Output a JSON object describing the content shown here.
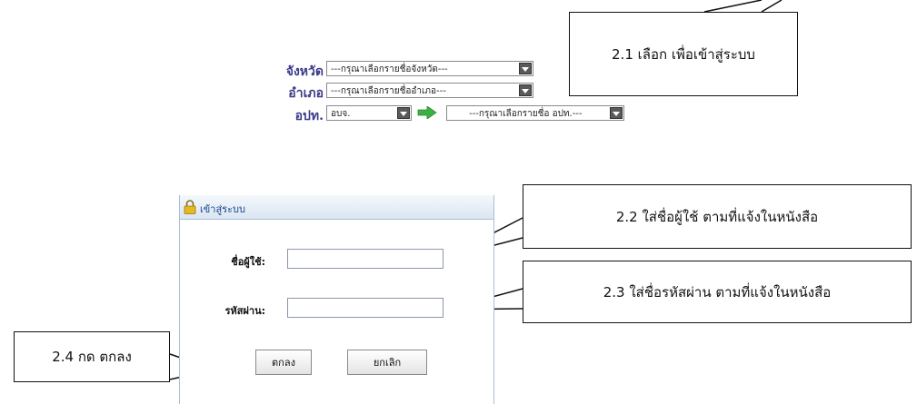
{
  "selector": {
    "province_label": "จังหวัด",
    "province_value": "---กรุณาเลือกรายชื่อจังหวัด---",
    "district_label": "อำเภอ",
    "district_value": "---กรุณาเลือกรายชื่ออำเภอ---",
    "org_label": "อปท.",
    "org_type_value": "อบจ.",
    "org_value": "---กรุณาเลือกรายชื่อ อปท.---"
  },
  "login": {
    "title": "เข้าสู่ระบบ",
    "username_label": "ชื่อผู้ใช้:",
    "password_label": "รหัสผ่าน:",
    "username_value": "",
    "password_value": "",
    "ok_label": "ตกลง",
    "cancel_label": "ยกเลิก"
  },
  "callouts": {
    "step_2_1": "2.1 เลือก เพื่อเข้าสู่ระบบ",
    "step_2_2": "2.2  ใส่ชื่อผู้ใช้ ตามที่แจ้งในหนังสือ",
    "step_2_3": "2.3  ใส่ชื่อรหัสผ่าน ตามที่แจ้งในหนังสือ",
    "step_2_4": "2.4  กด ตกลง"
  },
  "colors": {
    "label_blue": "#3a3a8a",
    "panel_header": "#dbe6f2",
    "go_arrow_green": "#3cb043"
  },
  "icons": {
    "lock": "lock-icon",
    "go": "green-arrow-icon"
  }
}
